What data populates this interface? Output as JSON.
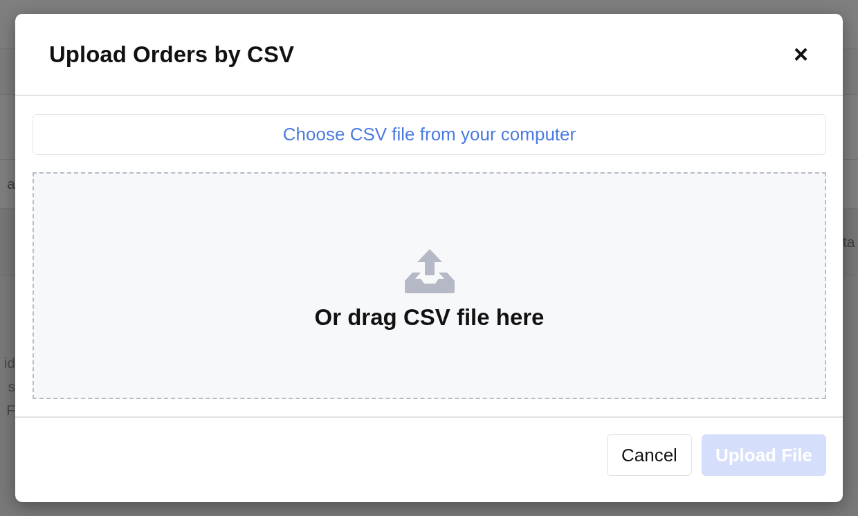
{
  "background": {
    "left_texts": [
      {
        "text": "a",
        "top": true
      },
      {
        "text": "id",
        "top": false
      },
      {
        "text": "s",
        "top": false
      },
      {
        "text": "F",
        "top": false
      }
    ],
    "right_texts": [
      "ta"
    ]
  },
  "dialog": {
    "title": "Upload Orders by CSV",
    "close": "×",
    "choose_button": "Choose CSV file from your computer",
    "dropzone_text": "Or drag CSV file here",
    "buttons": [
      {
        "label": "Cancel",
        "kind": "secondary",
        "disabled": false
      },
      {
        "label": "Upload File",
        "kind": "primary",
        "disabled": true
      }
    ]
  }
}
